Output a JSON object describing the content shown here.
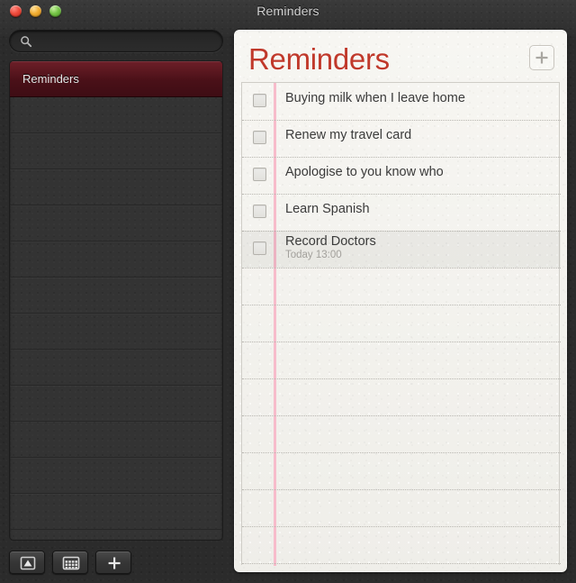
{
  "window": {
    "title": "Reminders",
    "controls": [
      {
        "name": "close",
        "color": "#ef4b3c"
      },
      {
        "name": "minimize",
        "color": "#f2ae31"
      },
      {
        "name": "zoom",
        "color": "#74c545"
      }
    ]
  },
  "sidebar": {
    "search": {
      "value": "",
      "placeholder": "",
      "icon": "search-icon"
    },
    "lists": [
      {
        "label": "Reminders",
        "selected": true
      },
      {
        "label": "",
        "selected": false
      },
      {
        "label": "",
        "selected": false
      },
      {
        "label": "",
        "selected": false
      },
      {
        "label": "",
        "selected": false
      },
      {
        "label": "",
        "selected": false
      },
      {
        "label": "",
        "selected": false
      },
      {
        "label": "",
        "selected": false
      },
      {
        "label": "",
        "selected": false
      },
      {
        "label": "",
        "selected": false
      },
      {
        "label": "",
        "selected": false
      },
      {
        "label": "",
        "selected": false
      },
      {
        "label": "",
        "selected": false
      }
    ],
    "toolbar": [
      {
        "name": "reveal-button",
        "icon": "triangle-up-in-box-icon",
        "label": ""
      },
      {
        "name": "calendar-button",
        "icon": "calendar-grid-icon",
        "label": ""
      },
      {
        "name": "add-list-button",
        "icon": "plus-icon",
        "label": ""
      }
    ]
  },
  "main": {
    "title": "Reminders",
    "title_color": "#c0392b",
    "add_button_icon": "plus-icon",
    "reminders": [
      {
        "title": "Buying milk when I leave home",
        "subtitle": "",
        "checked": false,
        "selected": false
      },
      {
        "title": "Renew my travel card",
        "subtitle": "",
        "checked": false,
        "selected": false
      },
      {
        "title": "Apologise to you know who",
        "subtitle": "",
        "checked": false,
        "selected": false
      },
      {
        "title": "Learn Spanish",
        "subtitle": "",
        "checked": false,
        "selected": false
      },
      {
        "title": "Record Doctors",
        "subtitle": "Today 13:00",
        "checked": false,
        "selected": true
      }
    ],
    "blank_rule_count": 8
  }
}
